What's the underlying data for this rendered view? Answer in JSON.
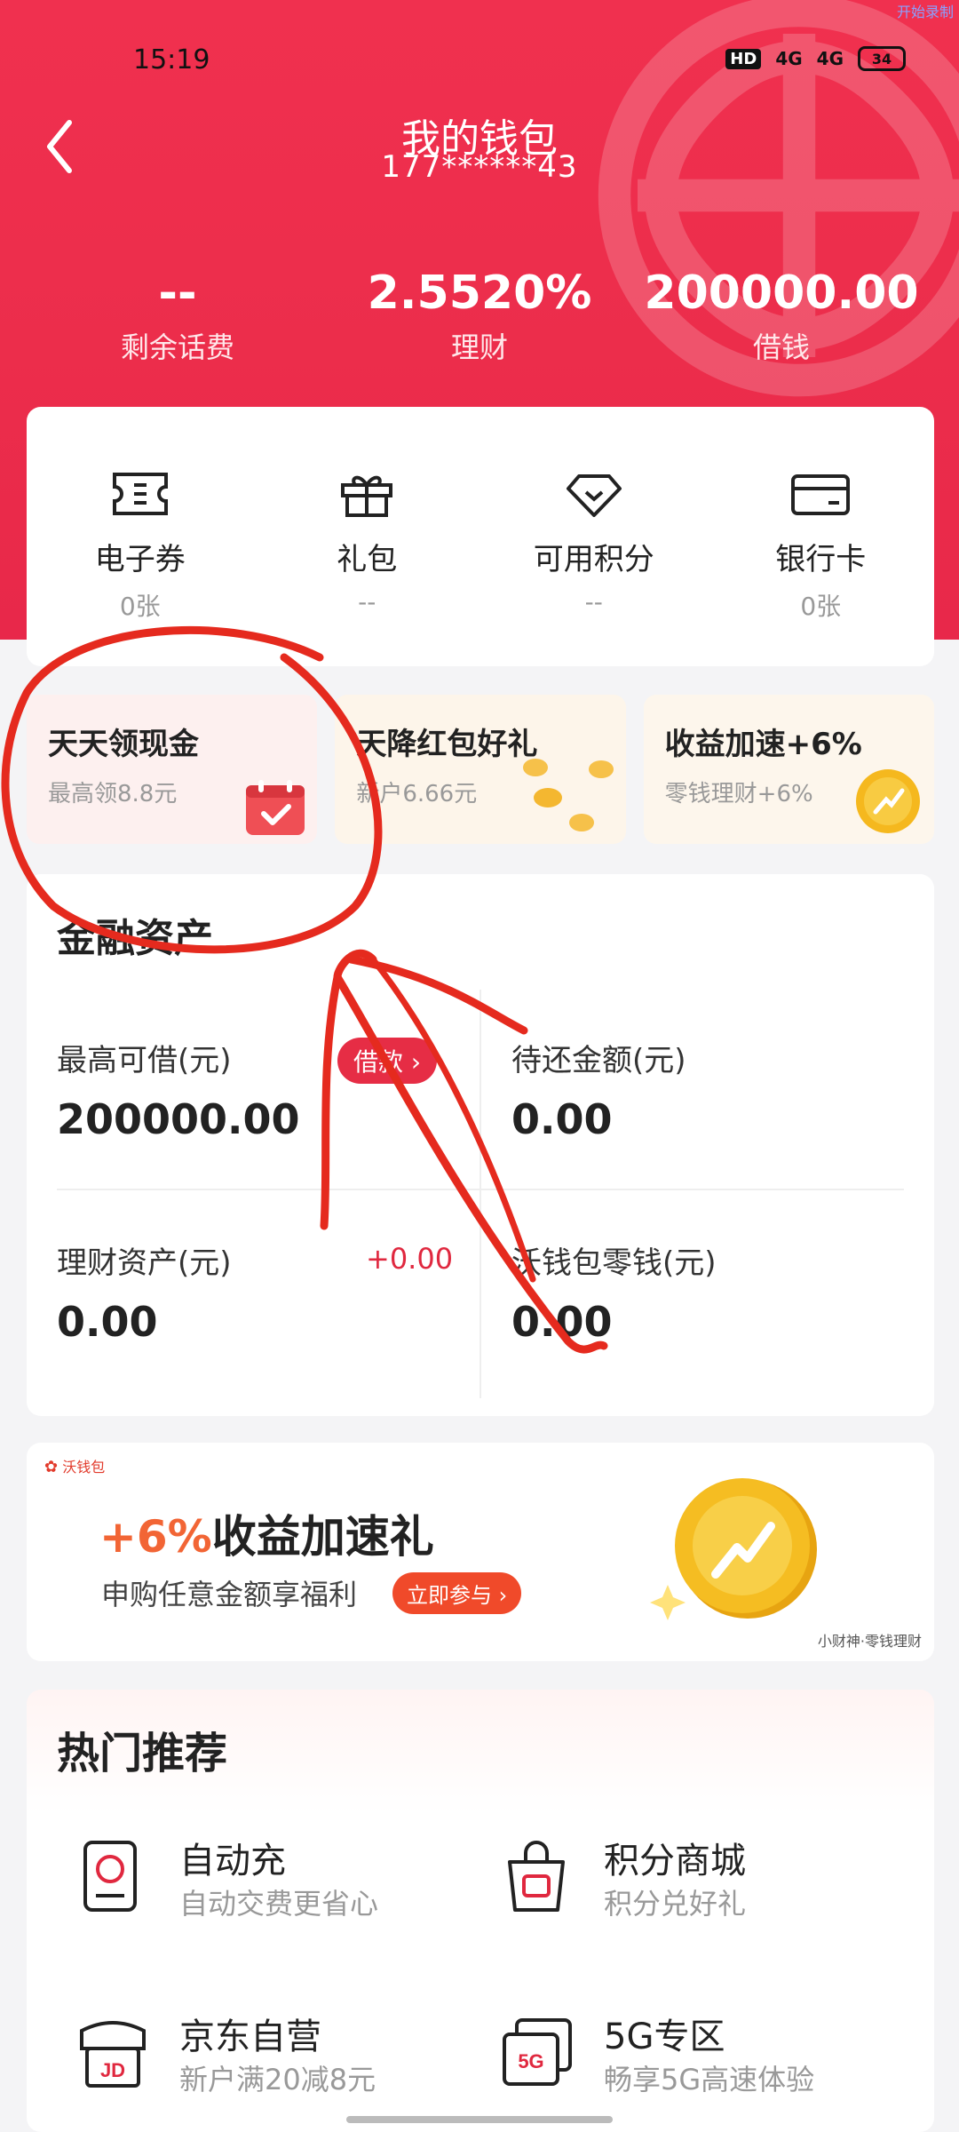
{
  "status": {
    "time": "15:19",
    "hd": "HD",
    "net1": "4G",
    "net2": "4G",
    "battery": "34",
    "corner_note": "开始录制"
  },
  "header": {
    "title": "我的钱包",
    "phone": "177******43"
  },
  "stats": [
    {
      "value": "--",
      "label": "剩余话费"
    },
    {
      "value": "2.5520%",
      "label": "理财"
    },
    {
      "value": "200000.00",
      "label": "借钱"
    }
  ],
  "quick": [
    {
      "icon": "ticket-icon",
      "label": "电子券",
      "sub": "0张"
    },
    {
      "icon": "gift-icon",
      "label": "礼包",
      "sub": "--"
    },
    {
      "icon": "diamond-icon",
      "label": "可用积分",
      "sub": "--"
    },
    {
      "icon": "bank-card-icon",
      "label": "银行卡",
      "sub": "0张"
    }
  ],
  "promos": [
    {
      "title": "天天领现金",
      "sub": "最高领8.8元"
    },
    {
      "title": "天降红包好礼",
      "sub": "新户6.66元"
    },
    {
      "title": "收益加速+6%",
      "sub": "零钱理财+6%"
    }
  ],
  "assets": {
    "title": "金融资产",
    "loan_max_label": "最高可借(元)",
    "loan_max_value": "200000.00",
    "loan_button": "借款",
    "repay_label": "待还金额(元)",
    "repay_value": "0.00",
    "wealth_label": "理财资产(元)",
    "wealth_value": "0.00",
    "wealth_change": "+0.00",
    "change_label": "沃钱包零钱(元)",
    "change_value": "0.00"
  },
  "banner": {
    "logo": "沃钱包",
    "title_accent": "+6%",
    "title_rest": "收益加速礼",
    "sub": "申购任意金额享福利",
    "button": "立即参与",
    "caption": "小财神·零钱理财"
  },
  "hot": {
    "title": "热门推荐",
    "items": [
      {
        "icon": "auto-recharge-icon",
        "name": "自动充",
        "sub": "自动交费更省心"
      },
      {
        "icon": "points-mall-icon",
        "name": "积分商城",
        "sub": "积分兑好礼"
      },
      {
        "icon": "jd-icon",
        "name": "京东自营",
        "sub": "新户满20减8元"
      },
      {
        "icon": "5g-icon",
        "name": "5G专区",
        "sub": "畅享5G高速体验"
      }
    ]
  },
  "colors": {
    "brand_red": "#ec2d4b",
    "accent_orange": "#f26535",
    "coin_gold": "#f5b81e"
  }
}
